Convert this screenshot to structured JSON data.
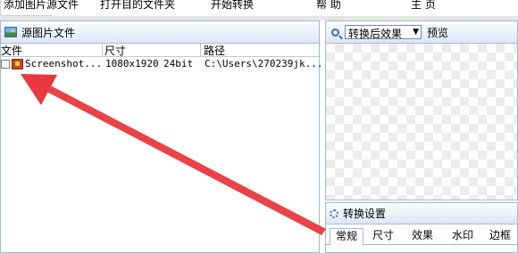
{
  "menu": {
    "items": [
      "添加图片源文件",
      "打开目的文件夹",
      "开始转换",
      "帮 助",
      "主 页"
    ]
  },
  "source_panel": {
    "title": "源图片文件",
    "columns": [
      "文件",
      "尺寸",
      "路径"
    ],
    "rows": [
      {
        "name": "Screenshot...",
        "size": "1080x1920",
        "depth": "24bit",
        "path": "C:\\Users\\270239jk..."
      }
    ]
  },
  "preview_panel": {
    "mode_value": "转换后效果",
    "label": "预览"
  },
  "settings_panel": {
    "title": "转换设置",
    "tabs": [
      "常规",
      "尺寸",
      "效果",
      "水印",
      "边框"
    ],
    "active_tab": "常规"
  },
  "colors": {
    "panel_border": "#a7b7cf",
    "annotation_arrow": "#e8383d"
  }
}
